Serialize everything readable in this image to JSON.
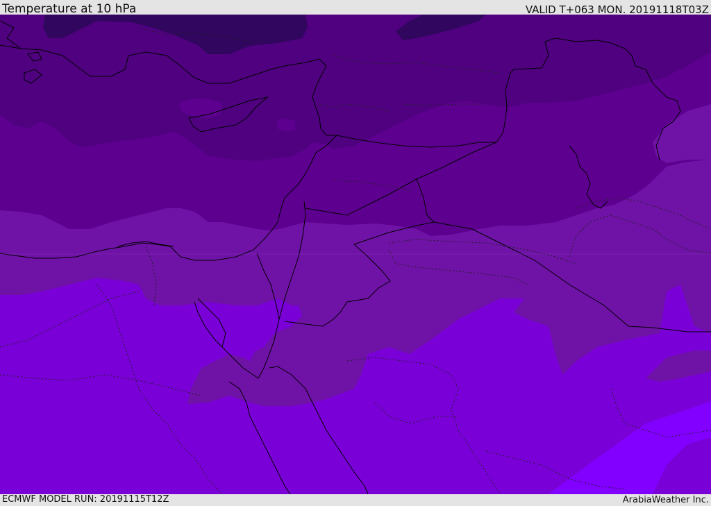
{
  "header": {
    "title": "Temperature at 10 hPa",
    "valid": "VALID T+063 MON. 20191118T03Z"
  },
  "footer": {
    "model_run": "ECMWF MODEL RUN: 20191115T12Z",
    "brand": "ArabiaWeather Inc."
  },
  "map": {
    "variable": "temperature",
    "level": "10 hPa",
    "bands": [
      {
        "name": "band-darkest",
        "color": "#30065e"
      },
      {
        "name": "band-dark",
        "color": "#4f0180"
      },
      {
        "name": "band-mid-dark",
        "color": "#5d0090"
      },
      {
        "name": "band-mid",
        "color": "#6f12a6"
      },
      {
        "name": "band-light",
        "color": "#7a00d8"
      },
      {
        "name": "band-lightest",
        "color": "#8200ff"
      }
    ],
    "coastline_color": "#000000",
    "border_style": "dotted"
  }
}
